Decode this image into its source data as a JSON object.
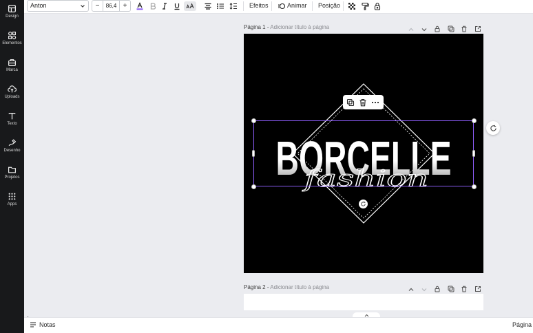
{
  "sidebar": {
    "items": [
      {
        "label": "Design",
        "icon": "layout-icon"
      },
      {
        "label": "Elementos",
        "icon": "shapes-icon"
      },
      {
        "label": "Marca",
        "icon": "brand-icon"
      },
      {
        "label": "Uploads",
        "icon": "cloud-upload-icon"
      },
      {
        "label": "Texto",
        "icon": "text-icon"
      },
      {
        "label": "Desenho",
        "icon": "draw-icon"
      },
      {
        "label": "Projetos",
        "icon": "folder-icon"
      },
      {
        "label": "Apps",
        "icon": "apps-grid-icon"
      }
    ]
  },
  "toolbar": {
    "font": "Anton",
    "font_size": "86,4",
    "minus": "−",
    "plus": "+",
    "effects": "Efeitos",
    "animate": "Animar",
    "position": "Posição",
    "text_color": "#8b5cf6"
  },
  "pages": [
    {
      "label": "Página 1",
      "sep": " - ",
      "placeholder": "Adicionar título à página"
    },
    {
      "label": "Página 2",
      "sep": " - ",
      "placeholder": "Adicionar título à página"
    }
  ],
  "design": {
    "title": "BORCELLE",
    "subtitle": "fashion",
    "background": "#000000",
    "selection_color": "#8b5cf6"
  },
  "bottom": {
    "notes": "Notas",
    "page_indicator": "Página"
  }
}
